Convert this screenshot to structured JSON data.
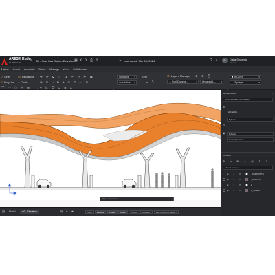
{
  "app": {
    "brand": "ARES® Kudo",
    "brand_sub": "CLOUD CAD",
    "document_title": "3D - New Gas Station Elevation...",
    "saved_status": "Last saved: Mar 06, 2024",
    "user": {
      "initials": "D",
      "name": "Dalia Sedaroiu",
      "role": "Viewer"
    },
    "colors": {
      "accent": "#e57a1f",
      "canopy_orange": "#e8802c",
      "dark_panel": "#26282c"
    }
  },
  "menu": {
    "tabs": [
      "Home",
      "Insert",
      "Annotate",
      "Sheet",
      "Manage",
      "View",
      "Collaborate"
    ],
    "active": "Home"
  },
  "ribbon": {
    "draw": {
      "line": "Line",
      "polyline": "PolyLine",
      "rectangle": "Rectangle",
      "circle": "Circle",
      "group_label": "DRAW"
    },
    "modify": {
      "group_label": "MODIFY"
    },
    "annotation": {
      "text_style": "Standard",
      "dim_style": "Annotative",
      "text": "Text",
      "group_label": "ANNOTATION"
    },
    "layers": {
      "manager": "Layers Manager",
      "current_layer": "Fuel Dispens...",
      "state": "Unsaved L...",
      "group_label": "LAYERS"
    },
    "properties": {
      "color": "ByLayer",
      "linetype": "ByLayer"
    }
  },
  "properties_panel": {
    "title": "PROPERTIES",
    "selection": "NO ENTITIES SELECTED",
    "section_general": "GENERAL",
    "rows": [
      "ByLayer",
      "ByLayer",
      "Fuel Dispenser"
    ]
  },
  "layers_panel": {
    "title": "LAYERS",
    "filter_placeholder": "Filter # of layers",
    "layers": [
      "_DEFPOINTS",
      "_ACM-CYL",
      "0",
      "A_Fixture"
    ]
  },
  "command": {
    "placeholder": "Type a command"
  },
  "statusbar": {
    "tabs": [
      "Model",
      "A0 - Elevation"
    ],
    "active_tab": "A0 - Elevation",
    "toggles": [
      "SNAP",
      "LWEIGHT",
      "POLAR",
      "ESNAP",
      "ETRACK",
      "AMBIENT",
      "RECTANGULAR SELECT"
    ],
    "on_toggles": [
      "LWEIGHT",
      "POLAR",
      "ESNAP"
    ]
  }
}
